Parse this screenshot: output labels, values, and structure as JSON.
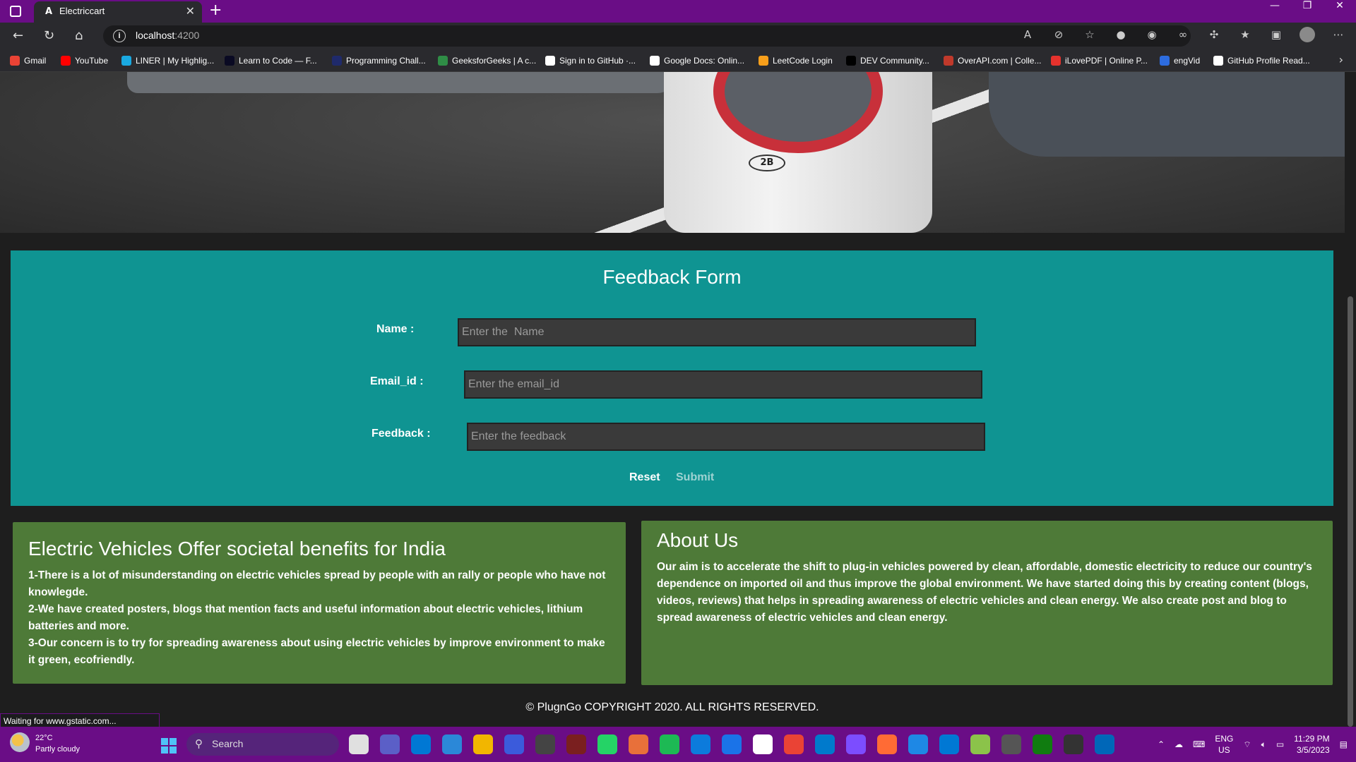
{
  "browser": {
    "tab_favicon": "A",
    "tab_title": "Electriccart",
    "url_host": "localhost",
    "url_port": ":4200",
    "bookmarks": [
      {
        "label": "Gmail",
        "color": "#ea4335"
      },
      {
        "label": "YouTube",
        "color": "#ff0000"
      },
      {
        "label": "LINER | My Highlig...",
        "color": "#1aa9e1"
      },
      {
        "label": "Learn to Code — F...",
        "color": "#0a0a23"
      },
      {
        "label": "Programming Chall...",
        "color": "#1f2a6b"
      },
      {
        "label": "GeeksforGeeks | A c...",
        "color": "#2f8d46"
      },
      {
        "label": "Sign in to GitHub ·...",
        "color": "#ffffff"
      },
      {
        "label": "Google Docs: Onlin...",
        "color": "#ffffff"
      },
      {
        "label": "LeetCode Login",
        "color": "#f89f1b"
      },
      {
        "label": "DEV Community...",
        "color": "#000000"
      },
      {
        "label": "OverAPI.com | Colle...",
        "color": "#c0392b"
      },
      {
        "label": "iLovePDF | Online P...",
        "color": "#e5322d"
      },
      {
        "label": "engVid",
        "color": "#2d6cdf"
      },
      {
        "label": "GitHub Profile Read...",
        "color": "#ffffff"
      }
    ]
  },
  "page": {
    "feedback": {
      "title": "Feedback Form",
      "name_label": "Name :",
      "name_placeholder": "Enter the  Name",
      "email_label": "Email_id :",
      "email_placeholder": "Enter the email_id",
      "feedback_label": "Feedback :",
      "feedback_placeholder": "Enter the feedback",
      "reset_label": "Reset",
      "submit_label": "Submit"
    },
    "benefits": {
      "title": "Electric Vehicles Offer societal benefits for India",
      "point1": "1-There is a lot of misunderstanding on electric vehicles spread by people with an rally or people who have not knowlegde.",
      "point2": "2-We have created posters, blogs that mention facts and useful information about electric vehicles, lithium batteries and more.",
      "point3": "3-Our concern is to try for spreading awareness about using electric vehicles by improve environment to make it green, ecofriendly."
    },
    "about": {
      "title": "About Us",
      "body": "Our aim is to accelerate the shift to plug-in vehicles powered by clean, affordable, domestic electricity to reduce our country's dependence on imported oil and thus improve the global environment. We have started doing this by creating content (blogs, videos, reviews) that helps in spreading awareness of electric vehicles and clean energy. We also create post and blog to spread awareness of electric vehicles and clean energy."
    },
    "hero_badge": "2B",
    "footer": "© PlugnGo COPYRIGHT 2020. ALL RIGHTS RESERVED."
  },
  "status_text": "Waiting for www.gstatic.com...",
  "taskbar": {
    "temp": "22°C",
    "weather": "Partly cloudy",
    "search_label": "Search",
    "lang_top": "ENG",
    "lang_bottom": "US",
    "time": "11:29 PM",
    "date": "3/5/2023",
    "app_colors": [
      "#e0e0e0",
      "#5b5fc7",
      "#0078d4",
      "#2b88d8",
      "#f2b600",
      "#3b5bdb",
      "#444",
      "#7a1f1f",
      "#25d366",
      "#e8703a",
      "#1db954",
      "#0c7bdc",
      "#1a73e8",
      "#ffffff",
      "#ea4335",
      "#007acc",
      "#7c4dff",
      "#ff6b35",
      "#1e88e5",
      "#0078d4",
      "#8bc34a",
      "#555",
      "#107c10",
      "#333",
      "#0067b8"
    ]
  },
  "colors": {
    "browser_accent": "#6a0d86",
    "feedback_bg": "#0f9492",
    "card_bg": "#4e7a38",
    "submit_text": "#9fd3d2"
  }
}
